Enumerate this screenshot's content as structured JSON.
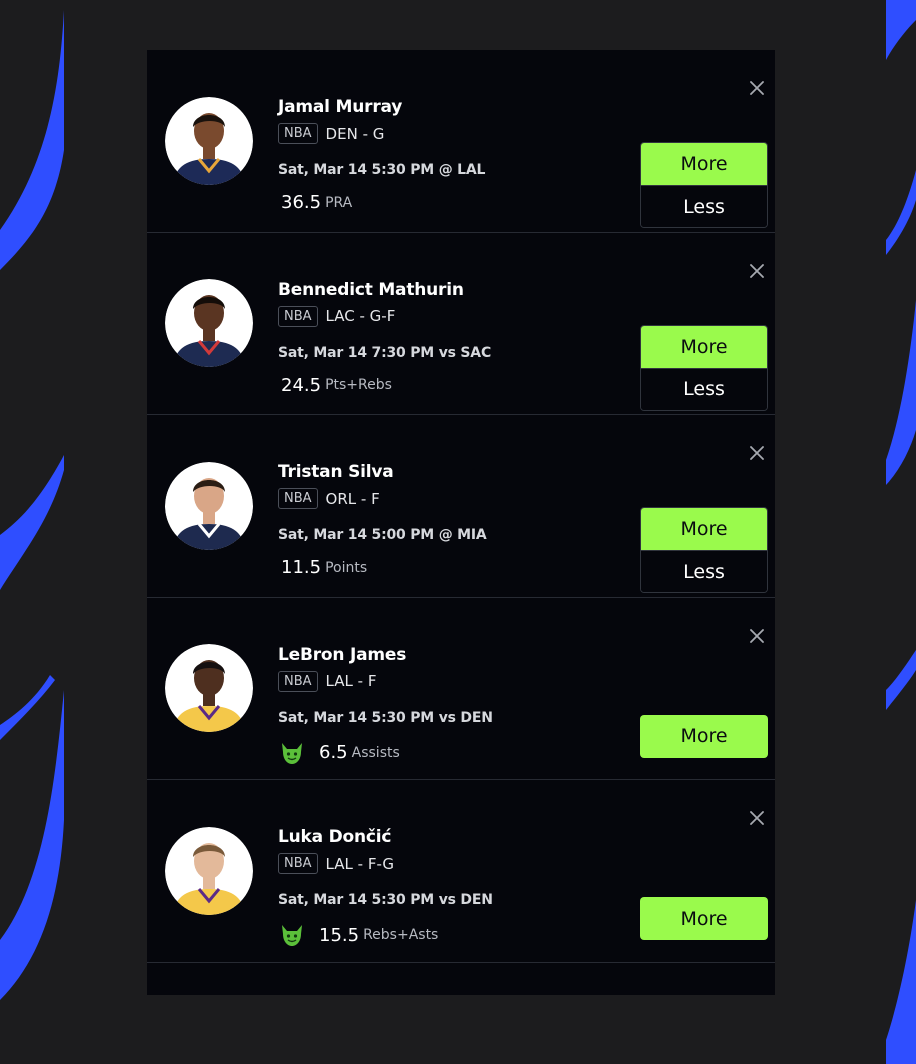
{
  "colors": {
    "page_bg": "#1c1c1e",
    "panel_bg": "#05060c",
    "accent_green": "#9afa4c",
    "swoosh_blue": "#2f4eff"
  },
  "icons": {
    "close": "close-icon",
    "demon": "demon-icon"
  },
  "picks": [
    {
      "name": "Jamal Murray",
      "league": "NBA",
      "team_pos": "DEN - G",
      "game": "Sat, Mar 14 5:30 PM @ LAL",
      "line": "36.5",
      "stat": "PRA",
      "more_label": "More",
      "less_label": "Less",
      "jersey_color": "#1d2a57",
      "jersey_trim": "#e8a63a",
      "skin": "#7a4a2e",
      "hair": "#1a120d"
    },
    {
      "name": "Bennedict Mathurin",
      "league": "NBA",
      "team_pos": "LAC - G-F",
      "game": "Sat, Mar 14 7:30 PM vs SAC",
      "line": "24.5",
      "stat": "Pts+Rebs",
      "more_label": "More",
      "less_label": "Less",
      "jersey_color": "#1e2b52",
      "jersey_trim": "#d23a3a",
      "skin": "#5a3522",
      "hair": "#140d09"
    },
    {
      "name": "Tristan Silva",
      "league": "NBA",
      "team_pos": "ORL - F",
      "game": "Sat, Mar 14 5:00 PM @ MIA",
      "line": "11.5",
      "stat": "Points",
      "more_label": "More",
      "less_label": "Less",
      "jersey_color": "#1e2a4f",
      "jersey_trim": "#ffffff",
      "skin": "#d9a687",
      "hair": "#2a1d14"
    },
    {
      "name": "LeBron James",
      "league": "NBA",
      "team_pos": "LAL - F",
      "game": "Sat, Mar 14 5:30 PM vs DEN",
      "line": "6.5",
      "stat": "Assists",
      "more_label": "More",
      "demon": true,
      "jersey_color": "#f4c84a",
      "jersey_trim": "#5b2a86",
      "skin": "#4e2f1f",
      "hair": "#151010"
    },
    {
      "name": "Luka Dončić",
      "league": "NBA",
      "team_pos": "LAL - F-G",
      "game": "Sat, Mar 14 5:30 PM vs DEN",
      "line": "15.5",
      "stat": "Rebs+Asts",
      "more_label": "More",
      "demon": true,
      "jersey_color": "#f4c84a",
      "jersey_trim": "#5b2a86",
      "skin": "#e3b99a",
      "hair": "#7a5a3a"
    }
  ]
}
